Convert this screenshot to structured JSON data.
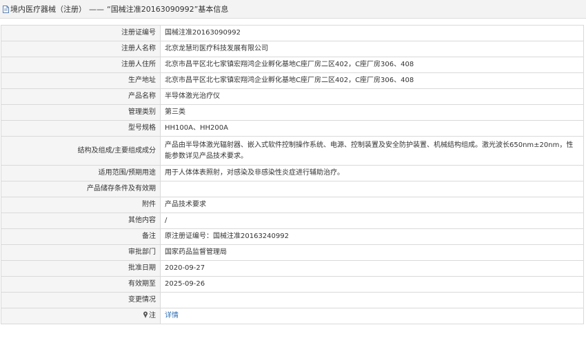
{
  "header": {
    "category": "境内医疗器械（注册）",
    "separator": "——",
    "title": "“国械注准20163090992”基本信息"
  },
  "rows": [
    {
      "label": "注册证编号",
      "value": "国械注准20163090992"
    },
    {
      "label": "注册人名称",
      "value": "北京龙慧珩医疗科技发展有限公司"
    },
    {
      "label": "注册人住所",
      "value": "北京市昌平区北七家镇宏翔鸿企业孵化基地C座厂房二区402，C座厂房306、408"
    },
    {
      "label": "生产地址",
      "value": "北京市昌平区北七家镇宏翔鸿企业孵化基地C座厂房二区402，C座厂房306、408"
    },
    {
      "label": "产品名称",
      "value": "半导体激光治疗仪"
    },
    {
      "label": "管理类别",
      "value": "第三类"
    },
    {
      "label": "型号规格",
      "value": "HH100A、HH200A"
    },
    {
      "label": "结构及组成/主要组成成分",
      "value": "产品由半导体激光辐射器、嵌入式软件控制操作系统、电源、控制装置及安全防护装置、机械结构组成。激光波长650nm±20nm，性能参数详见产品技术要求。"
    },
    {
      "label": "适用范围/预期用途",
      "value": "用于人体体表照射，对感染及非感染性炎症进行辅助治疗。"
    },
    {
      "label": "产品储存条件及有效期",
      "value": ""
    },
    {
      "label": "附件",
      "value": "产品技术要求"
    },
    {
      "label": "其他内容",
      "value": "/"
    },
    {
      "label": "备注",
      "value": "原注册证编号：国械注准20163240992"
    },
    {
      "label": "审批部门",
      "value": "国家药品监督管理局"
    },
    {
      "label": "批准日期",
      "value": "2020-09-27"
    },
    {
      "label": "有效期至",
      "value": "2025-09-26"
    },
    {
      "label": "变更情况",
      "value": ""
    }
  ],
  "note_row": {
    "label": "注",
    "link": "详情",
    "icon": "pin-icon"
  }
}
